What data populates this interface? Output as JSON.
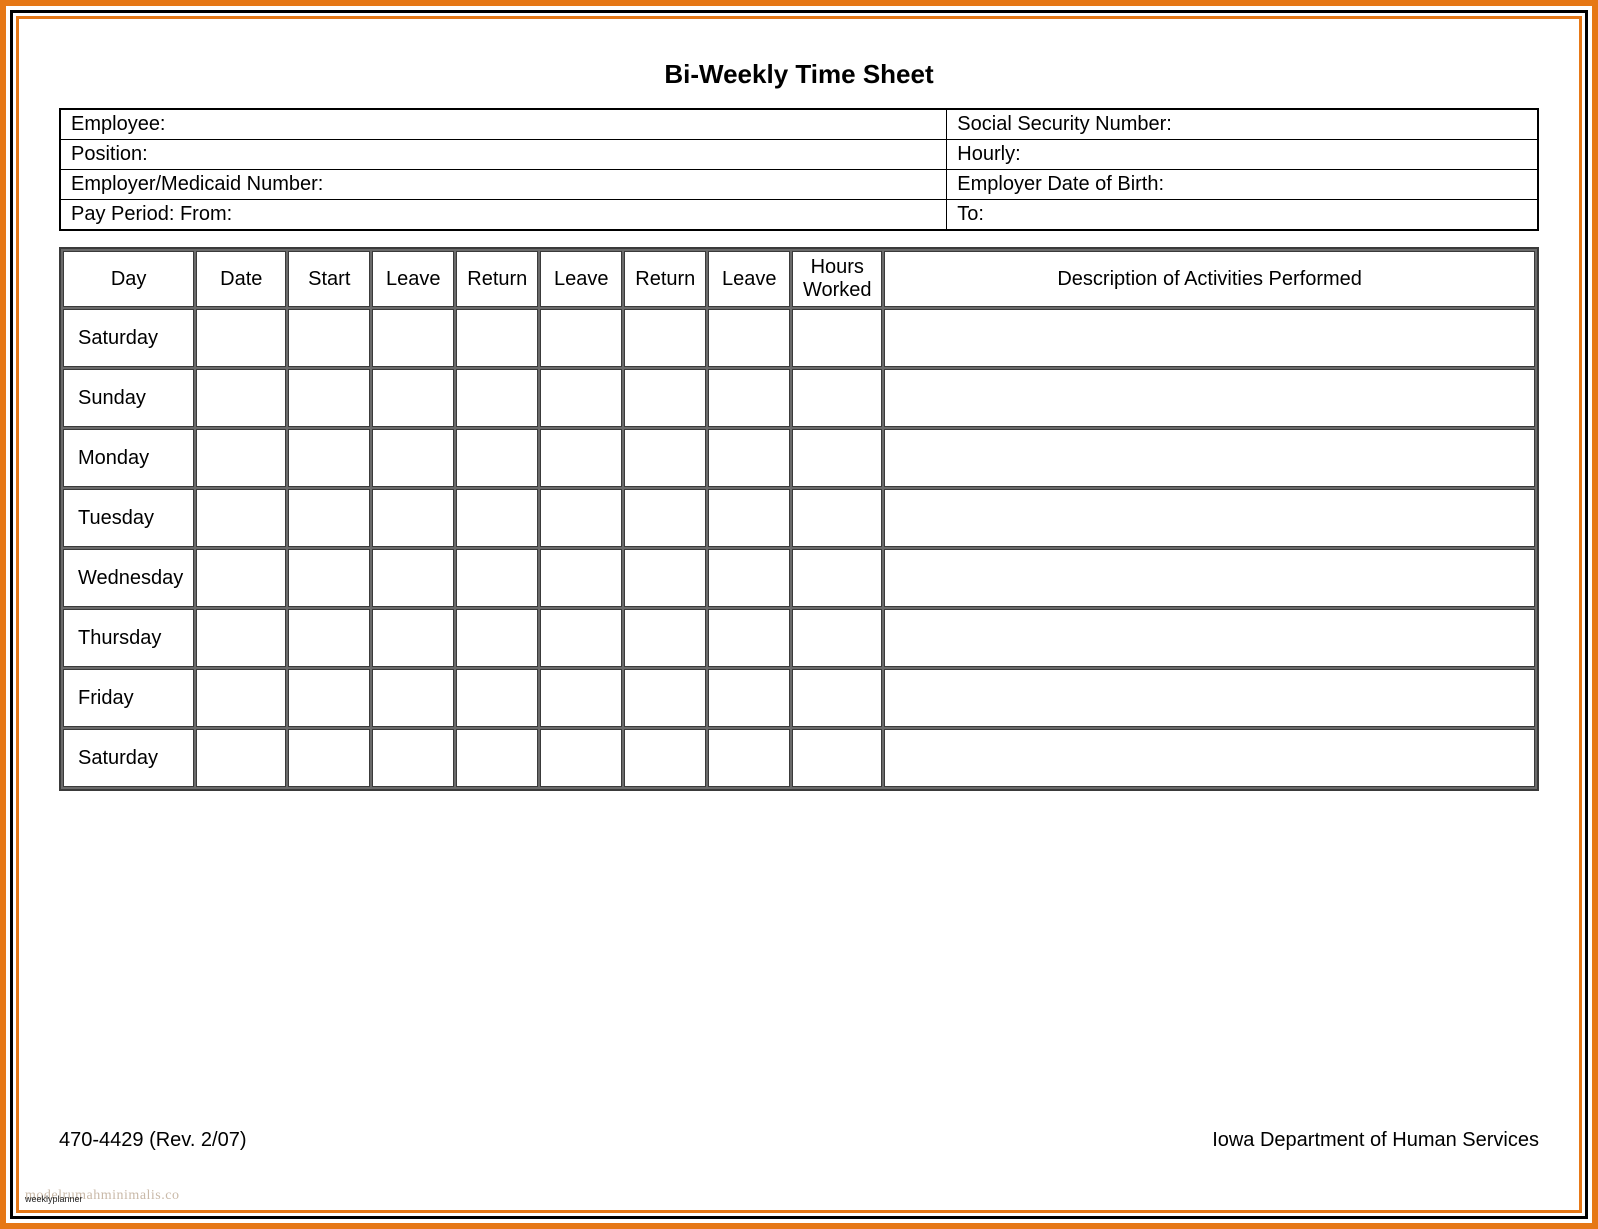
{
  "title": "Bi-Weekly Time Sheet",
  "info": {
    "employee_label": "Employee:",
    "ssn_label": "Social Security Number:",
    "position_label": "Position:",
    "hourly_label": "Hourly:",
    "employer_medicaid_label": "Employer/Medicaid Number:",
    "employer_dob_label": "Employer Date of Birth:",
    "pay_period_from_label": "Pay Period:  From:",
    "pay_period_to_label": "To:"
  },
  "columns": {
    "day": "Day",
    "date": "Date",
    "start": "Start",
    "leave1": "Leave",
    "return1": "Return",
    "leave2": "Leave",
    "return2": "Return",
    "leave3": "Leave",
    "hours": "Hours Worked",
    "desc": "Description of Activities Performed"
  },
  "rows": [
    {
      "day": "Saturday"
    },
    {
      "day": "Sunday"
    },
    {
      "day": "Monday"
    },
    {
      "day": "Tuesday"
    },
    {
      "day": "Wednesday"
    },
    {
      "day": "Thursday"
    },
    {
      "day": "Friday"
    },
    {
      "day": "Saturday"
    }
  ],
  "footer": {
    "form_number": "470-4429  (Rev. 2/07)",
    "dept": "Iowa Department of Human Services"
  },
  "watermark": "modelrumahminimalis.co",
  "watermark2": "weeklyplanner"
}
